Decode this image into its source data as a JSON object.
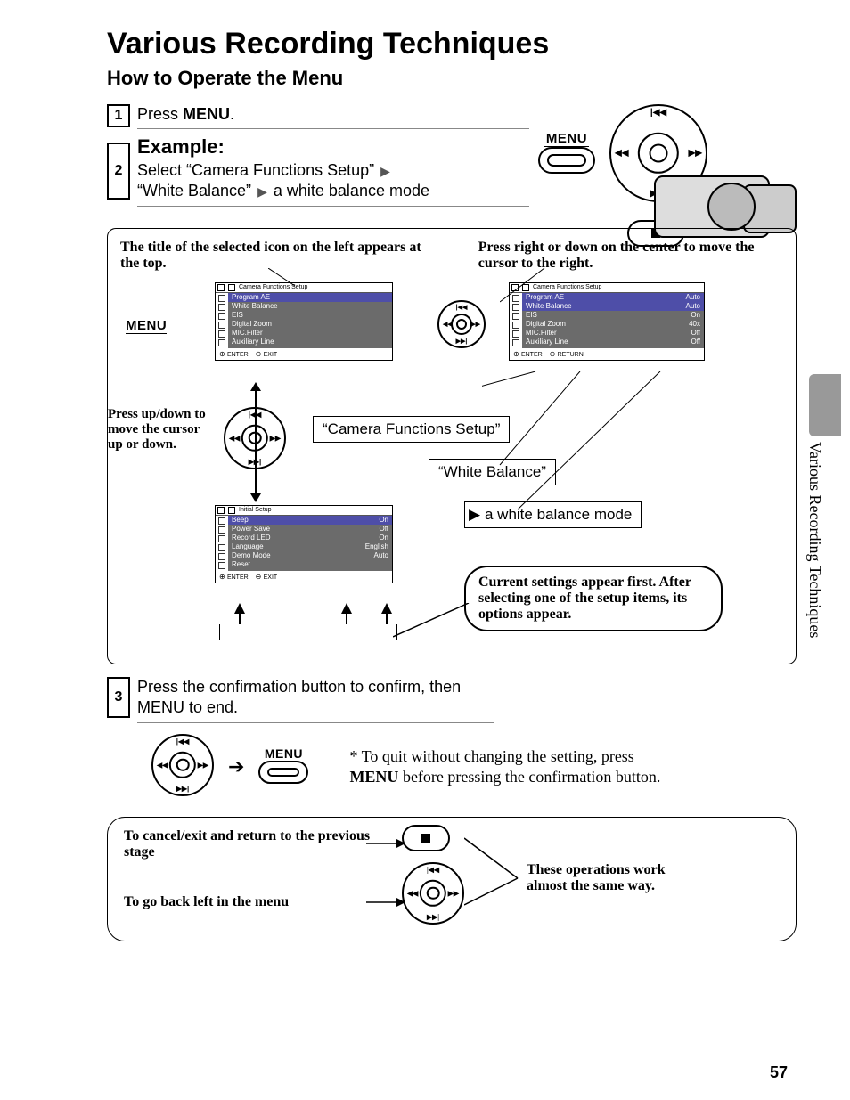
{
  "title": "Various Recording Techniques",
  "subtitle": "How to Operate the Menu",
  "side_tab": "Various Recording Techniques",
  "page_number": "57",
  "step1": {
    "pre": "Press ",
    "bold": "MENU",
    "post": "."
  },
  "step2": {
    "example": "Example:",
    "line1_pre": "Select “Camera Functions Setup”",
    "line2_a": "“White Balance”",
    "line2_b": "a white balance mode"
  },
  "step3": {
    "text": "Press the confirmation button to confirm, then MENU to end."
  },
  "top_menu_label": "MENU",
  "diagram": {
    "top_left_label": "The title of the selected icon on the left appears at the top.",
    "top_right_label": "Press right or down on the center to move the cursor to the right.",
    "left_note": "Press up/down to move the cursor up or down.",
    "menu_label": "MENU",
    "callout1": "“Camera Functions Setup”",
    "callout2": "“White Balance”",
    "callout3": "a white balance mode",
    "bubble": "Current settings appear first. After selecting one of the setup items, its options appear."
  },
  "screen1": {
    "title": "Camera Functions Setup",
    "rows": [
      "Program AE",
      "White Balance",
      "EIS",
      "Digital Zoom",
      "MIC.Filter",
      "Auxiliary Line"
    ],
    "footer_enter": "ENTER",
    "footer_exit": "EXIT"
  },
  "screen2": {
    "title": "Camera Functions Setup",
    "rows": [
      {
        "l": "Program AE",
        "r": "Auto"
      },
      {
        "l": "White Balance",
        "r": "Auto"
      },
      {
        "l": "EIS",
        "r": "On"
      },
      {
        "l": "Digital Zoom",
        "r": "40x"
      },
      {
        "l": "MIC.Filter",
        "r": "Off"
      },
      {
        "l": "Auxiliary Line",
        "r": "Off"
      }
    ],
    "footer_enter": "ENTER",
    "footer_return": "RETURN"
  },
  "screen3": {
    "title": "Initial Setup",
    "rows": [
      {
        "l": "Beep",
        "r": "On"
      },
      {
        "l": "Power Save",
        "r": "Off"
      },
      {
        "l": "Record LED",
        "r": "On"
      },
      {
        "l": "Language",
        "r": "English"
      },
      {
        "l": "Demo Mode",
        "r": "Auto"
      },
      {
        "l": "Reset",
        "r": ""
      }
    ],
    "footer_enter": "ENTER",
    "footer_exit": "EXIT"
  },
  "quit_note": {
    "pre": "* To quit without changing the setting, press ",
    "bold": "MENU",
    "post": " before pressing the confirmation button."
  },
  "bottom_box": {
    "line1": "To cancel/exit and return to the previous stage",
    "line2": "To go back left in the menu",
    "right": "These operations work almost the same way."
  },
  "bottom_menu_label": "MENU"
}
